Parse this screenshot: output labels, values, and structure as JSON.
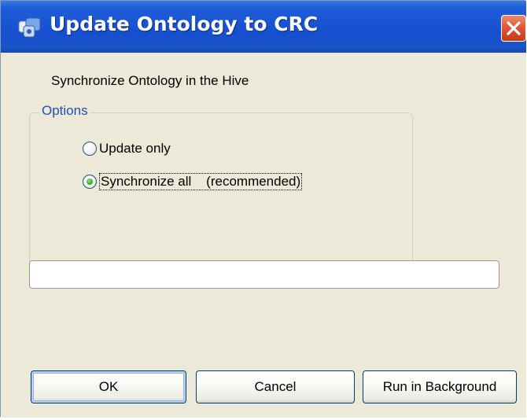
{
  "dialog": {
    "title": "Update Ontology to CRC",
    "subtitle": "Synchronize Ontology in the Hive",
    "options_group": {
      "legend": "Options",
      "radios": [
        {
          "label": "Update only",
          "selected": false
        },
        {
          "label": "Synchronize all    (recommended)",
          "selected": true
        }
      ]
    },
    "progress": 0,
    "buttons": {
      "ok": "OK",
      "cancel": "Cancel",
      "run_background": "Run in Background"
    }
  },
  "colors": {
    "titlebar": "#1550d0",
    "window_bg": "#ece9d8",
    "legend_text": "#1f4fb3",
    "close_button": "#e0573a",
    "radio_dot": "#3fae33"
  },
  "icons": {
    "title": "ontology-app-icon",
    "close": "close-icon"
  }
}
